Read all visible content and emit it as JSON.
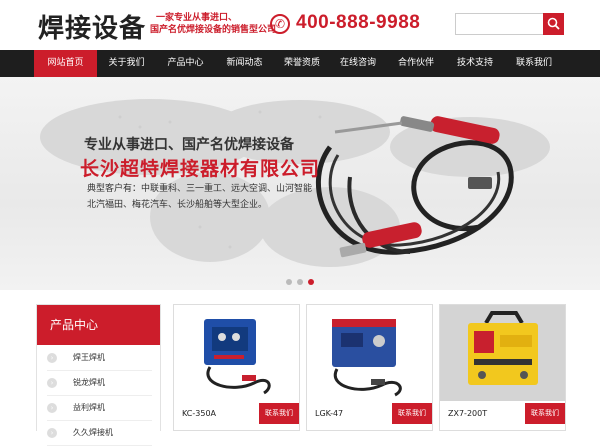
{
  "header": {
    "logo": "焊接设备",
    "slogan_line1": "一家专业从事进口、",
    "slogan_line2": "国产名优焊接设备的销售型公司",
    "phone": "400-888-9988"
  },
  "nav": {
    "items": [
      "网站首页",
      "关于我们",
      "产品中心",
      "新闻动态",
      "荣誉资质",
      "在线咨询",
      "合作伙伴",
      "技术支持",
      "联系我们"
    ],
    "active_index": 0
  },
  "banner": {
    "line1": "专业从事进口、国产名优焊接设备",
    "line2": "长沙超特焊接器材有限公司",
    "line3": "典型客户有：中联重科、三一重工、远大空调、山河智能",
    "line4": "北汽福田、梅花汽车、长沙船舶等大型企业。",
    "slide_count": 3,
    "active_slide": 2
  },
  "sidebar": {
    "title": "产品中心",
    "items": [
      "焊王焊机",
      "锐龙焊机",
      "益利焊机",
      "久久焊接机"
    ]
  },
  "products": [
    {
      "name": "KC-350A",
      "button": "联系我们"
    },
    {
      "name": "LGK-47",
      "button": "联系我们"
    },
    {
      "name": "ZX7-200T",
      "button": "联系我们"
    }
  ],
  "colors": {
    "accent": "#cc1d2b",
    "nav_bg": "#1e1e1e"
  }
}
